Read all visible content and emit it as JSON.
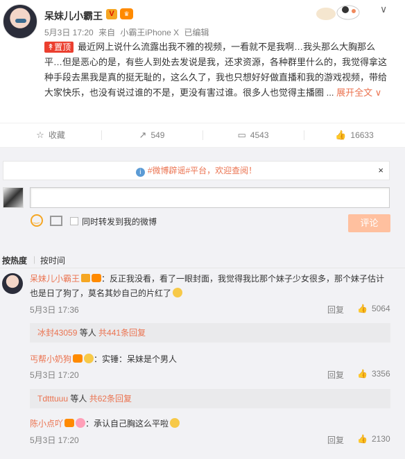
{
  "post": {
    "username": "呆妹儿小霸王",
    "badge_v": "V",
    "date": "5月3日 17:20",
    "from_label": "来自",
    "device": "小霸王iPhone X",
    "edited": "已编辑",
    "pinned_label": "置顶",
    "text": "最近网上说什么流露出我不雅的视频，一看就不是我啊…我头那么大胸那么平…但是恶心的是，有些人到处去发说是我，还求资源，各种群里什么的，我觉得拿这种手段去黑我是真的挺无耻的，这么久了，我也只想好好做直播和我的游戏视频，带给大家快乐，也没有说过谁的不是，更没有害过谁。很多人也觉得主播圈 ...",
    "expand_label": "展开全文",
    "expand_icon": "chevron-down-icon"
  },
  "actions": {
    "favorite": "收藏",
    "forward": "549",
    "comment": "4543",
    "like": "16633"
  },
  "notice": {
    "prefix": "",
    "topic": "#微博辟谣#平台，欢迎查阅！",
    "close": "×"
  },
  "composer": {
    "placeholder": "",
    "forward_label": "同时转发到我的微博",
    "submit_label": "评论"
  },
  "sort": {
    "hot": "按热度",
    "separator": "|",
    "time": "按时间"
  },
  "comments": [
    {
      "name": "呆妹儿小霸王",
      "badge_v": "V",
      "text": "：反正我没看，看了一眼封面，我觉得我比那个妹子少女很多，那个妹子估计也是日了狗了，莫名其妙自己的片红了",
      "time": "5月3日 17:36",
      "reply": "回复",
      "likes": "5064",
      "sub_name": "冰封43059",
      "sub_text": " 等人 ",
      "sub_count": "共441条回复"
    },
    {
      "name": "丐帮小奶狗",
      "text": "：实锤：呆妹是个男人",
      "time": "5月3日 17:20",
      "reply": "回复",
      "likes": "3356",
      "sub_name": "Tdtttuuu",
      "sub_text": " 等人 ",
      "sub_count": "共62条回复"
    },
    {
      "name": "陈小点吖",
      "text": "：承认自己胸这么平啦",
      "time": "5月3日 17:20",
      "reply": "回复",
      "likes": "2130"
    }
  ],
  "colors": {
    "accent": "#eb7350",
    "pin": "#eb3f2f",
    "submit_disabled": "#ffc09f",
    "comment_bg": "#f2f2f5"
  }
}
